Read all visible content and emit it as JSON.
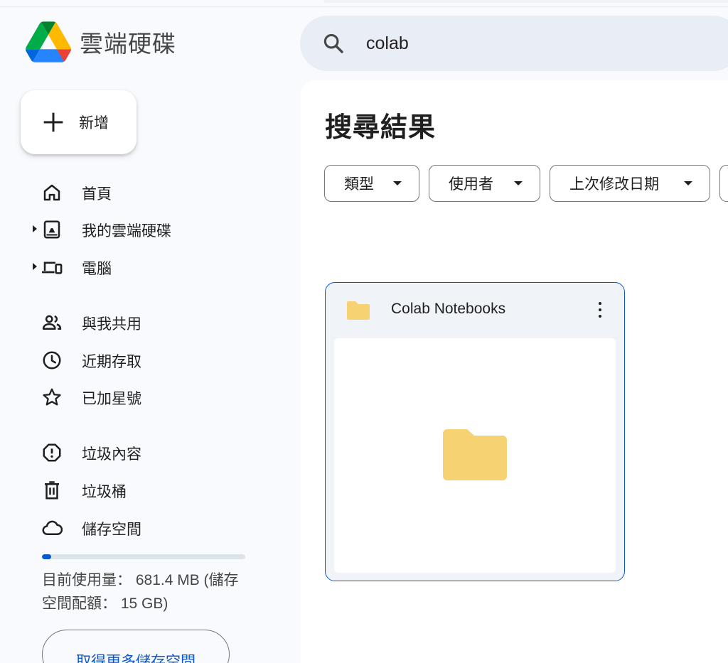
{
  "app": {
    "title": "雲端硬碟"
  },
  "search": {
    "value": "colab"
  },
  "new_button": {
    "label": "新增"
  },
  "sidebar": {
    "items": [
      {
        "label": "首頁",
        "icon": "home-icon"
      },
      {
        "label": "我的雲端硬碟",
        "icon": "my-drive-icon",
        "expandable": true
      },
      {
        "label": "電腦",
        "icon": "computers-icon",
        "expandable": true
      },
      {
        "label": "與我共用",
        "icon": "shared-people-icon"
      },
      {
        "label": "近期存取",
        "icon": "clock-icon"
      },
      {
        "label": "已加星號",
        "icon": "star-icon"
      },
      {
        "label": "垃圾內容",
        "icon": "spam-icon"
      },
      {
        "label": "垃圾桶",
        "icon": "trash-icon"
      },
      {
        "label": "儲存空間",
        "icon": "cloud-icon"
      }
    ]
  },
  "storage": {
    "used_fraction": 0.044,
    "text": "目前使用量： 681.4 MB (儲存空間配額： 15 GB)",
    "more_button_label": "取得更多儲存空間"
  },
  "main": {
    "title": "搜尋結果",
    "filters": [
      {
        "label": "類型"
      },
      {
        "label": "使用者"
      },
      {
        "label": "上次修改日期"
      }
    ],
    "results": [
      {
        "name": "Colab Notebooks",
        "type": "folder-icon"
      }
    ]
  },
  "colors": {
    "accent": "#0b57d0",
    "folder": "#f6d272",
    "sidebar_bg": "#f8fafd",
    "search_bg": "#e9eef6"
  }
}
